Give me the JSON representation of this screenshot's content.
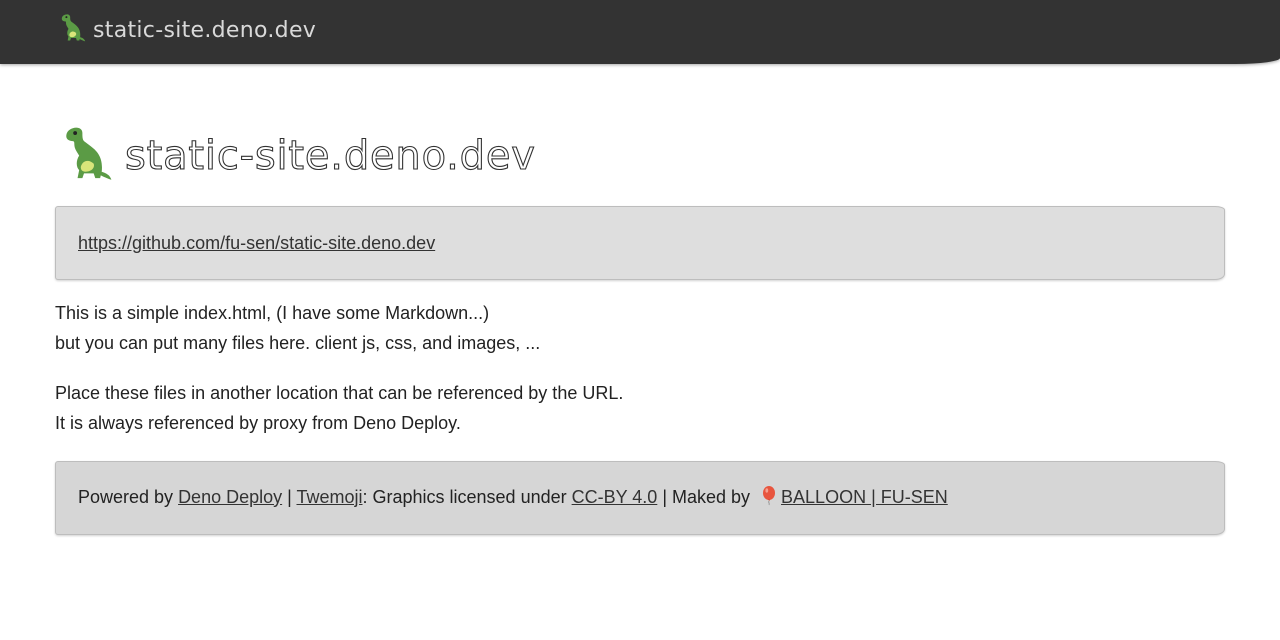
{
  "topbar": {
    "title": "static-site.deno.dev",
    "icon": "dinosaur-icon",
    "background": "#333333"
  },
  "header": {
    "title": "static-site.deno.dev",
    "icon": "dinosaur-icon"
  },
  "repo_link": {
    "text": "https://github.com/fu-sen/static-site.deno.dev"
  },
  "content": {
    "paragraph1": {
      "line1": "This is a simple index.html, (I have some Markdown...)",
      "line2": "but you can put many files here. client js, css, and images, ..."
    },
    "paragraph2": {
      "line1": "Place these files in another location that can be referenced by the URL.",
      "line2": "It is always referenced by proxy from Deno Deploy."
    }
  },
  "footer": {
    "powered_by": "Powered by ",
    "deno_deploy_link": "Deno Deploy",
    "sep1": " | ",
    "twemoji_link": "Twemoji",
    "graphics_text": ": Graphics licensed under ",
    "license_link": "CC-BY 4.0",
    "maked_by": " | Maked by ",
    "author_link": "BALLOON | FU-SEN",
    "author_icon": "balloon-icon"
  },
  "colors": {
    "panel": "#dedede",
    "footer_panel": "#d6d6d6",
    "text": "#222222",
    "link": "#333333"
  }
}
